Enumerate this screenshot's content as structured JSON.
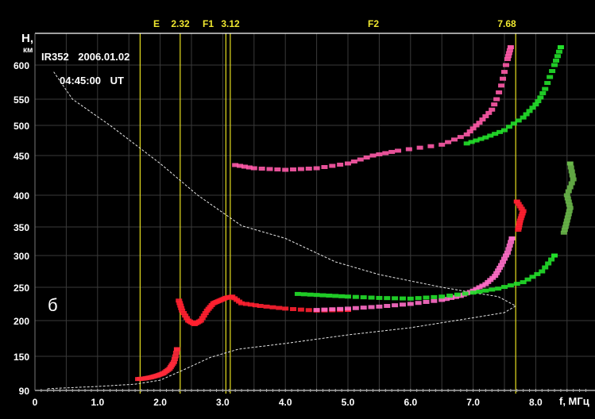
{
  "chart_data": {
    "type": "scatter",
    "title": "IR352 2006.01.02",
    "time": "04:45:00 UT",
    "panel_label": "б",
    "ylabel": "H,",
    "ylabel_unit": "км",
    "xlabel": "f, МГц",
    "xlim": [
      0,
      8.8
    ],
    "ylim": [
      90,
      640
    ],
    "x_ticks": [
      "0",
      "1.0",
      "2.0",
      "3.0",
      "4.0",
      "5.0",
      "6.0",
      "7.0",
      "8.0"
    ],
    "y_ticks": [
      "90",
      "150",
      "200",
      "250",
      "300",
      "350",
      "400",
      "450",
      "500",
      "550",
      "600"
    ],
    "grid": true,
    "markers": [
      {
        "label": "E",
        "f": 1.68
      },
      {
        "label": "2.32",
        "f": 2.32
      },
      {
        "label": "F1",
        "f": 3.05
      },
      {
        "label": "3.12",
        "f": 3.12
      },
      {
        "label": "F2",
        "f": null
      },
      {
        "label": "7.68",
        "f": 7.68
      }
    ],
    "series": [
      {
        "name": "E trace",
        "color": "#ff2a3a",
        "points": [
          [
            1.65,
            110
          ],
          [
            1.75,
            111
          ],
          [
            1.85,
            113
          ],
          [
            1.95,
            116
          ],
          [
            2.05,
            120
          ],
          [
            2.15,
            128
          ],
          [
            2.22,
            140
          ],
          [
            2.27,
            160
          ]
        ]
      },
      {
        "name": "F1 trace (O)",
        "color": "#ff2030",
        "points": [
          [
            2.3,
            230
          ],
          [
            2.35,
            215
          ],
          [
            2.45,
            200
          ],
          [
            2.55,
            195
          ],
          [
            2.65,
            200
          ],
          [
            2.75,
            215
          ],
          [
            2.85,
            226
          ],
          [
            2.95,
            230
          ],
          [
            3.05,
            234
          ],
          [
            3.15,
            236
          ],
          [
            3.3,
            226
          ],
          [
            3.6,
            222
          ],
          [
            4.0,
            218
          ],
          [
            4.5,
            215
          ],
          [
            5.0,
            216
          ]
        ]
      },
      {
        "name": "F2 trace (O)",
        "color": "#ff6ec8",
        "points": [
          [
            4.5,
            216
          ],
          [
            5.0,
            218
          ],
          [
            5.5,
            221
          ],
          [
            6.0,
            225
          ],
          [
            6.5,
            231
          ],
          [
            6.8,
            237
          ],
          [
            7.0,
            245
          ],
          [
            7.2,
            255
          ],
          [
            7.35,
            268
          ],
          [
            7.45,
            285
          ],
          [
            7.55,
            305
          ],
          [
            7.62,
            330
          ]
        ]
      },
      {
        "name": "F2 trace (X)",
        "color": "#22e02a",
        "points": [
          [
            4.2,
            240
          ],
          [
            4.6,
            238
          ],
          [
            5.0,
            236
          ],
          [
            5.5,
            234
          ],
          [
            6.0,
            233
          ],
          [
            6.5,
            236
          ],
          [
            7.0,
            242
          ],
          [
            7.4,
            248
          ],
          [
            7.8,
            258
          ],
          [
            8.1,
            275
          ],
          [
            8.3,
            300
          ]
        ]
      },
      {
        "name": "2nd hop (O)",
        "color": "#ff5aa8",
        "points": [
          [
            3.2,
            438
          ],
          [
            3.5,
            434
          ],
          [
            4.0,
            432
          ],
          [
            4.5,
            434
          ],
          [
            5.0,
            440
          ],
          [
            5.4,
            450
          ],
          [
            5.8,
            458
          ],
          [
            6.5,
            468
          ],
          [
            6.9,
            485
          ],
          [
            7.1,
            505
          ],
          [
            7.3,
            530
          ],
          [
            7.45,
            570
          ],
          [
            7.55,
            610
          ],
          [
            7.6,
            630
          ]
        ]
      },
      {
        "name": "2nd hop (X)",
        "color": "#22e02a",
        "points": [
          [
            6.9,
            470
          ],
          [
            7.2,
            480
          ],
          [
            7.5,
            492
          ],
          [
            7.8,
            515
          ],
          [
            8.0,
            540
          ],
          [
            8.15,
            565
          ],
          [
            8.3,
            600
          ],
          [
            8.4,
            630
          ]
        ]
      },
      {
        "name": "Oblique/extra",
        "color": "#ff2030",
        "points": [
          [
            7.72,
            345
          ],
          [
            7.75,
            360
          ],
          [
            7.8,
            375
          ],
          [
            7.7,
            390
          ]
        ]
      },
      {
        "name": "Extra X",
        "color": "#6ab84a",
        "points": [
          [
            8.45,
            340
          ],
          [
            8.5,
            360
          ],
          [
            8.55,
            380
          ],
          [
            8.5,
            400
          ],
          [
            8.6,
            420
          ],
          [
            8.55,
            440
          ]
        ]
      }
    ],
    "profile": {
      "name": "N(h) profile",
      "color": "#e8e8e8",
      "points": [
        [
          0.2,
          93
        ],
        [
          1.0,
          97
        ],
        [
          1.6,
          101
        ],
        [
          2.0,
          108
        ],
        [
          2.35,
          125
        ],
        [
          2.8,
          148
        ],
        [
          3.25,
          160
        ],
        [
          4.0,
          168
        ],
        [
          5.0,
          180
        ],
        [
          6.0,
          190
        ],
        [
          7.05,
          205
        ],
        [
          7.5,
          212
        ],
        [
          7.68,
          222
        ],
        [
          7.4,
          236
        ],
        [
          7.0,
          242
        ],
        [
          6.5,
          250
        ],
        [
          5.5,
          270
        ],
        [
          4.8,
          290
        ],
        [
          4.0,
          330
        ],
        [
          3.3,
          352
        ],
        [
          2.6,
          400
        ],
        [
          2.0,
          440
        ],
        [
          1.2,
          500
        ],
        [
          0.6,
          550
        ],
        [
          0.3,
          590
        ]
      ]
    }
  }
}
